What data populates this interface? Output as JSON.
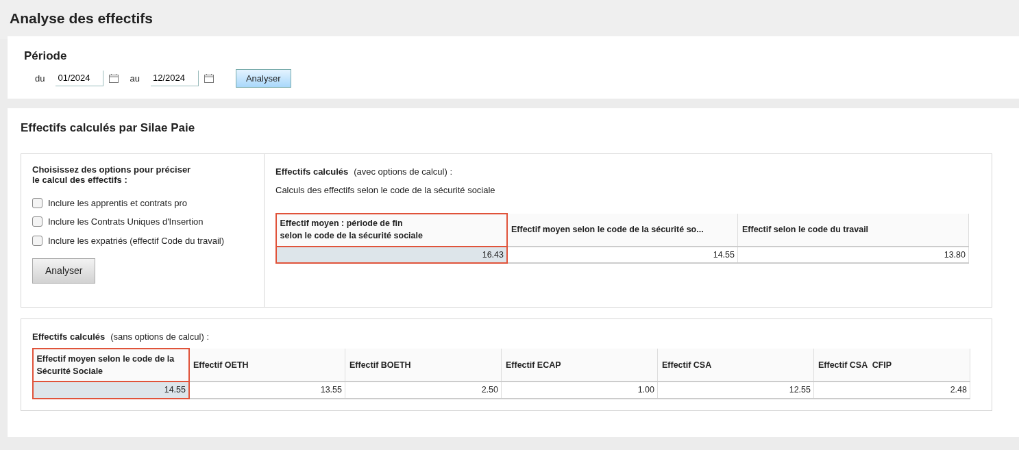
{
  "page": {
    "title": "Analyse des effectifs"
  },
  "period": {
    "title": "Période",
    "from_label": "du",
    "from_value": "01/2024",
    "to_label": "au",
    "to_value": "12/2024",
    "button": "Analyser"
  },
  "section": {
    "title": "Effectifs calculés par Silae Paie"
  },
  "options": {
    "title": "Choisissez des options pour préciser\nle calcul des effectifs :",
    "items": [
      {
        "label": "Inclure les apprentis et contrats pro",
        "checked": false
      },
      {
        "label": "Inclure les Contrats Uniques d'Insertion",
        "checked": false
      },
      {
        "label": "Inclure les expatriés (effectif Code du travail)",
        "checked": false
      }
    ],
    "button": "Analyser"
  },
  "with_options": {
    "title": "Effectifs calculés",
    "note": "(avec options de calcul) :",
    "subtitle": "Calculs des effectifs selon le code de la sécurité sociale",
    "columns": [
      {
        "label": "Effectif moyen : période de fin\nselon le code de la sécurité sociale",
        "selected": true
      },
      {
        "label": "Effectif moyen selon le code de la sécurité so...",
        "selected": false
      },
      {
        "label": "Effectif selon le code du travail",
        "selected": false
      }
    ],
    "rows": [
      [
        "16.43",
        "14.55",
        "13.80"
      ]
    ]
  },
  "without_options": {
    "title": "Effectifs calculés",
    "note": "(sans options de calcul) :",
    "columns": [
      {
        "label": "Effectif moyen selon le code de la\nSécurité Sociale",
        "selected": true
      },
      {
        "label": "Effectif OETH",
        "selected": false
      },
      {
        "label": "Effectif BOETH",
        "selected": false
      },
      {
        "label": "Effectif ECAP",
        "selected": false
      },
      {
        "label": "Effectif CSA",
        "selected": false
      },
      {
        "label": "Effectif CSA  CFIP",
        "selected": false
      }
    ],
    "rows": [
      [
        "14.55",
        "13.55",
        "2.50",
        "1.00",
        "12.55",
        "2.48"
      ]
    ]
  }
}
